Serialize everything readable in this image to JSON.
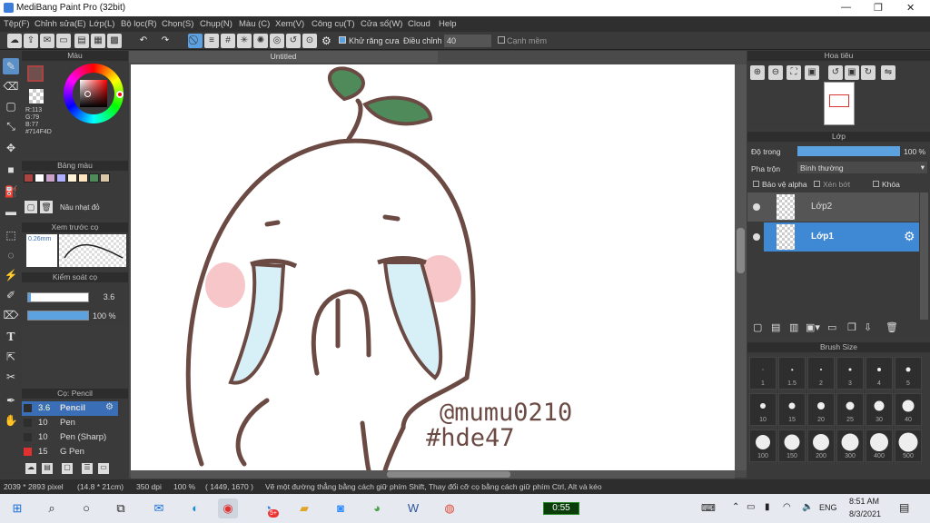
{
  "app": {
    "title": "MediBang Paint Pro (32bit)"
  },
  "menu": [
    "Tệp(F)",
    "Chỉnh sửa(E)",
    "Lớp(L)",
    "Bộ lọc(R)",
    "Chọn(S)",
    "Chụp(N)",
    "Màu (C)",
    "Xem(V)",
    "Công cụ(T)",
    "Cửa sổ(W)",
    "Cloud",
    "Help"
  ],
  "toolbar": {
    "antialias_label": "Khử răng cưa",
    "adjust_label": "Điều chỉnh",
    "adjust_value": "40",
    "edge_label": "Cạnh mềm"
  },
  "color_panel": {
    "title": "Màu",
    "r": "R:113",
    "g": "G:79",
    "b": "B:77",
    "hex": "#714F4D",
    "current_color": "#714F4D"
  },
  "palette_panel": {
    "title": "Bảng màu",
    "colors": [
      "#a94442",
      "#ffffff",
      "#c9a1c9",
      "#b0b0ff",
      "#fff4d6",
      "#ffe6c0",
      "#4f8a5b",
      "#d9c7a7"
    ],
    "name_label": "Nâu nhạt đỏ"
  },
  "preview_panel": {
    "title": "Xem trước cọ",
    "size": "0.26mm"
  },
  "brush_control": {
    "title": "Kiểm soát cọ",
    "size": "3.6",
    "opacity": "100 %"
  },
  "brush_list": {
    "title": "Cọ: Pencil",
    "items": [
      {
        "size": "3.6",
        "name": "Pencil",
        "color": "#3a6fb8",
        "selected": true
      },
      {
        "size": "10",
        "name": "Pen",
        "color": "#2e2e2e"
      },
      {
        "size": "10",
        "name": "Pen (Sharp)",
        "color": "#2e2e2e"
      },
      {
        "size": "15",
        "name": "G Pen",
        "color": "#e03030"
      }
    ]
  },
  "document": {
    "tab_label": "Untitled"
  },
  "canvas_text": {
    "line1": "@mumu0210",
    "line2": "#hde47"
  },
  "navigator": {
    "title": "Hoa tiêu"
  },
  "layer_panel": {
    "title": "Lớp",
    "opacity_label": "Độ trong",
    "opacity_value": "100 %",
    "blend_label": "Pha trộn",
    "blend_value": "Bình thường",
    "protect_alpha": "Bảo vệ alpha",
    "clip": "Xén bớt",
    "lock": "Khóa",
    "layers": [
      {
        "name": "Lớp2",
        "selected": false
      },
      {
        "name": "Lớp1",
        "selected": true
      }
    ]
  },
  "brush_size_panel": {
    "title": "Brush Size",
    "sizes": [
      "1",
      "1.5",
      "2",
      "3",
      "4",
      "5",
      "10",
      "15",
      "20",
      "25",
      "30",
      "40",
      "100",
      "150",
      "200",
      "300",
      "400",
      "500"
    ]
  },
  "status": {
    "dimensions": "2039 * 2893 pixel",
    "physical": "(14.8 * 21cm)",
    "dpi": "350 dpi",
    "zoom": "100 %",
    "coords": "( 1449, 1670 )",
    "hint": "Vẽ một đường thẳng bằng cách giữ phím Shift, Thay đổi cỡ cọ bằng cách giữ phím Ctrl, Alt và kéo"
  },
  "taskbar": {
    "timer": "0:55",
    "lang": "ENG",
    "time": "8:51 AM",
    "date": "8/3/2021",
    "notif_count": "5+"
  }
}
